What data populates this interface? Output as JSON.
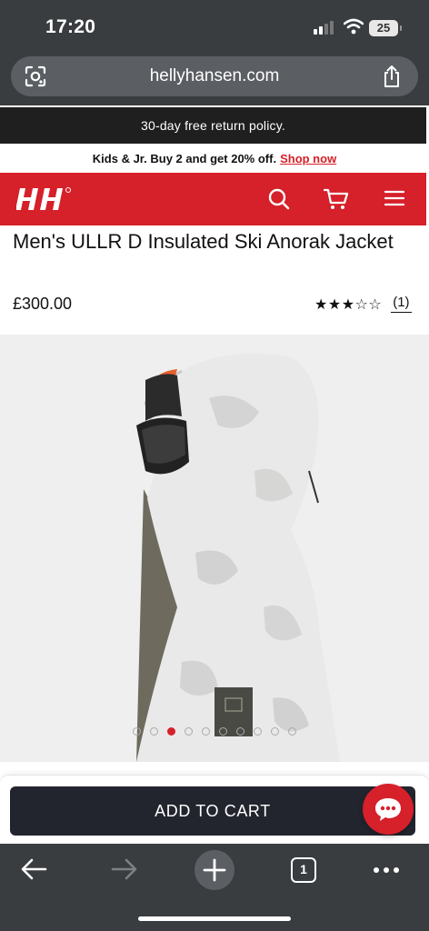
{
  "status_bar": {
    "time": "17:20",
    "battery": "25"
  },
  "browser": {
    "url": "hellyhansen.com",
    "tab_count": "1"
  },
  "banner": {
    "return_policy": "30-day free return policy."
  },
  "promo": {
    "text": "Kids & Jr. Buy 2 and get 20% off.",
    "link": "Shop now"
  },
  "header": {
    "logo": "HH"
  },
  "product": {
    "title": "Men's ULLR D Insulated Ski Anorak Jacket",
    "price": "£300.00",
    "rating": 3,
    "rating_max": 5,
    "stars": "★★★☆☆",
    "review_count": "(1)"
  },
  "gallery": {
    "image_count": 10,
    "active_index": 2
  },
  "cart": {
    "add_to_cart_label": "ADD TO CART"
  },
  "colors": {
    "brand_red": "#d6202a",
    "button_dark": "#22242e",
    "chrome": "#3a3d40"
  }
}
